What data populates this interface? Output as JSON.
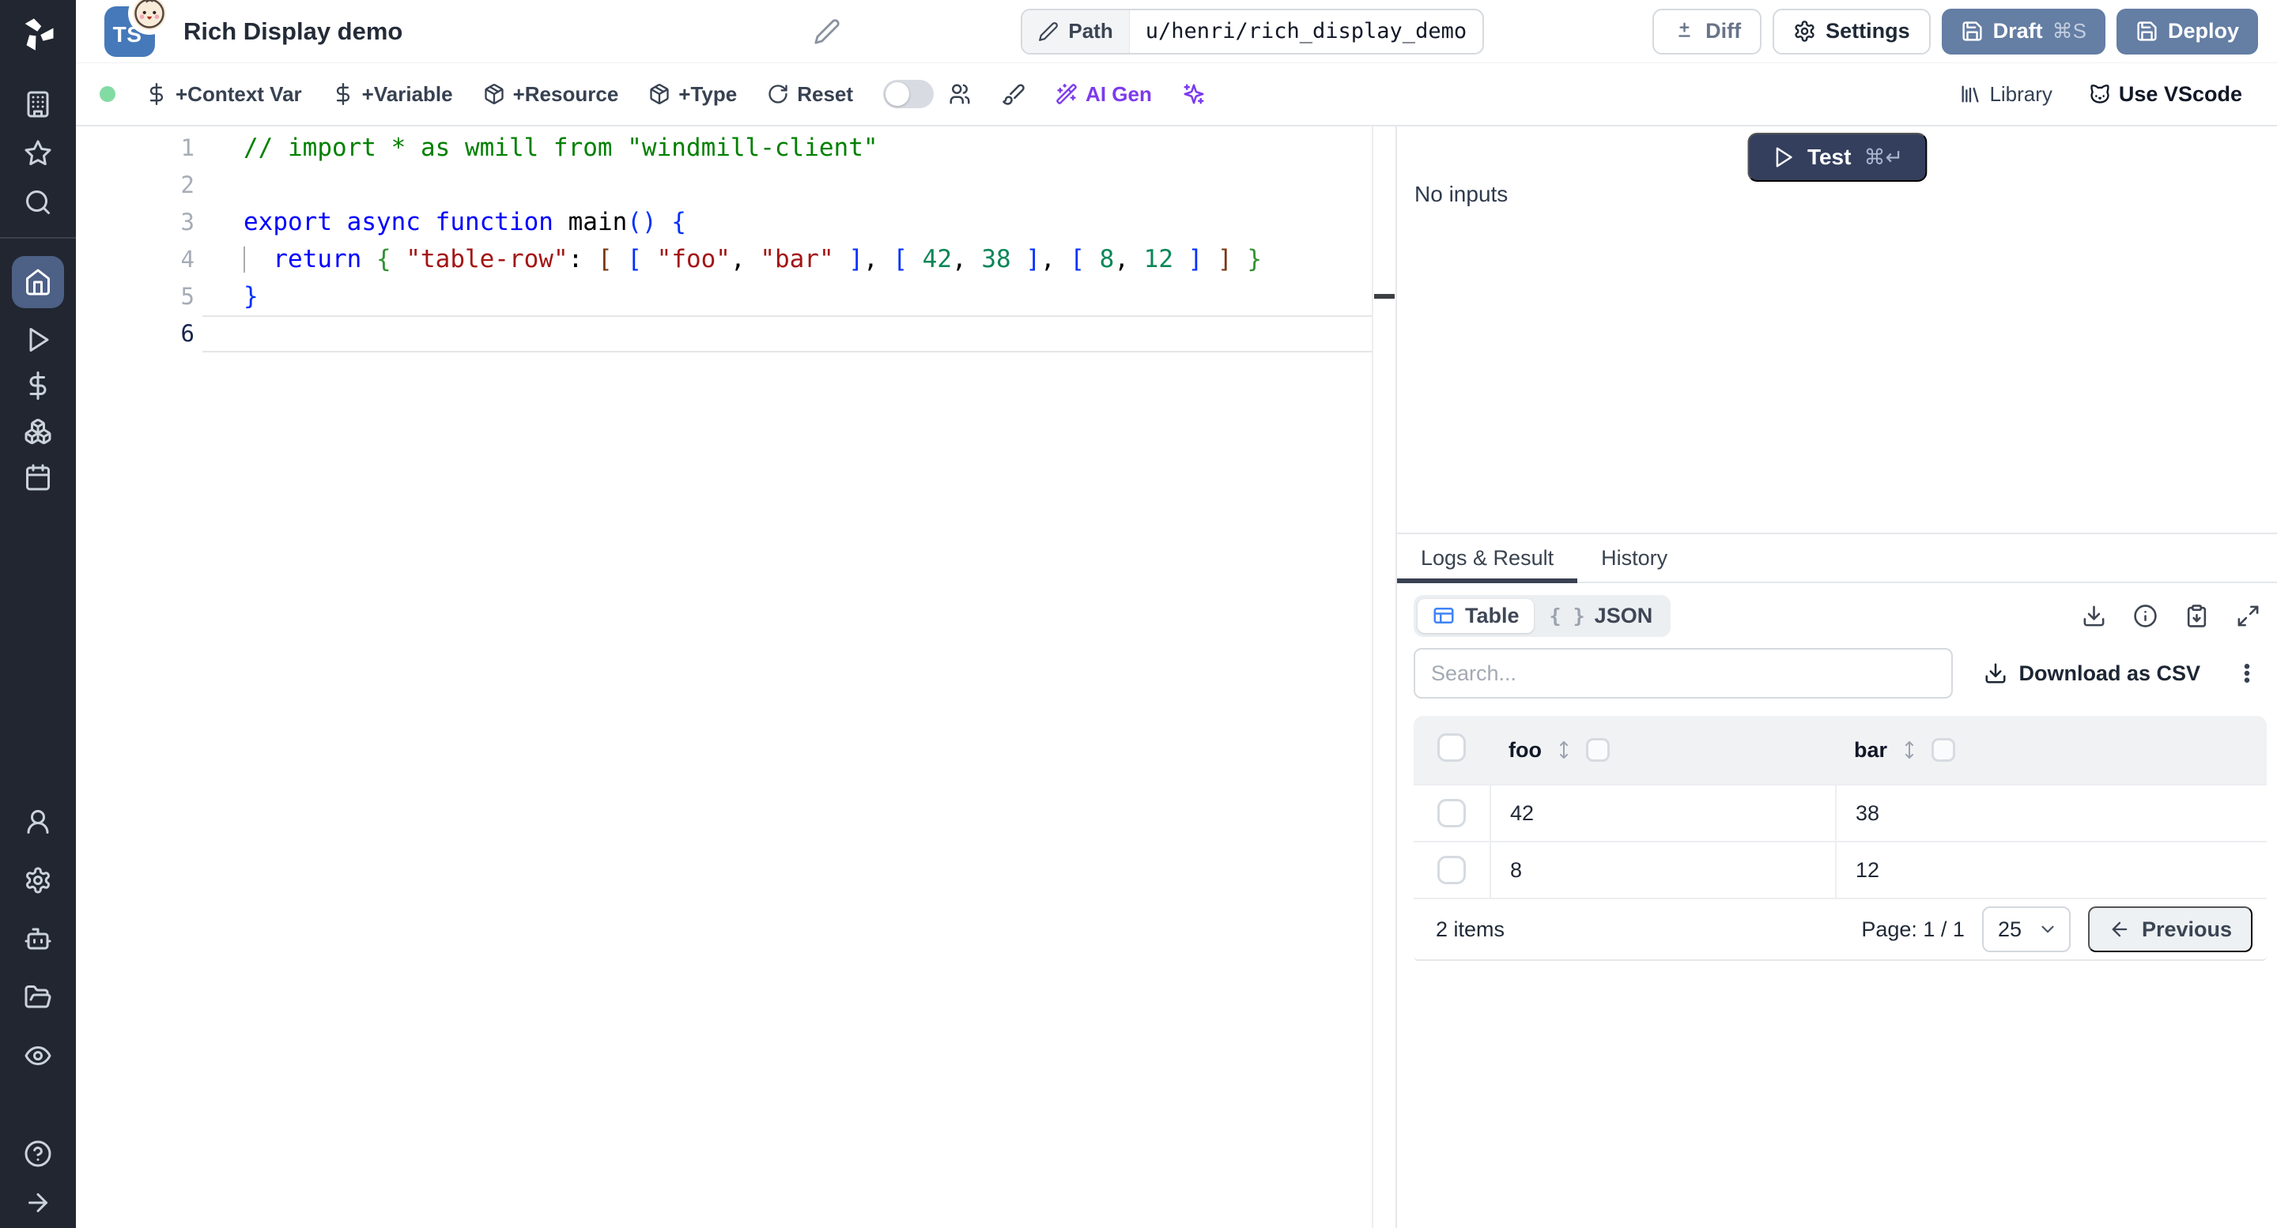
{
  "header": {
    "language_badge": "TS",
    "title": "Rich Display demo",
    "path_label": "Path",
    "path_value": "u/henri/rich_display_demo",
    "diff_label": "Diff",
    "settings_label": "Settings",
    "draft_label": "Draft",
    "draft_shortcut": "⌘S",
    "deploy_label": "Deploy"
  },
  "toolbar": {
    "context_var_label": "+Context Var",
    "variable_label": "+Variable",
    "resource_label": "+Resource",
    "type_label": "+Type",
    "reset_label": "Reset",
    "ai_gen_label": "AI Gen",
    "library_label": "Library",
    "vscode_label": "Use VScode"
  },
  "editor": {
    "lines": [
      {
        "num": "1",
        "tokens": [
          {
            "t": "// import * as wmill from \"windmill-client\"",
            "c": "comment"
          }
        ]
      },
      {
        "num": "2",
        "tokens": []
      },
      {
        "num": "3",
        "tokens": [
          {
            "t": "export",
            "c": "kw"
          },
          {
            "t": " ",
            "c": "plain"
          },
          {
            "t": "async",
            "c": "kw"
          },
          {
            "t": " ",
            "c": "plain"
          },
          {
            "t": "function",
            "c": "kw"
          },
          {
            "t": " ",
            "c": "plain"
          },
          {
            "t": "main",
            "c": "plain"
          },
          {
            "t": "()",
            "c": "b1"
          },
          {
            "t": " ",
            "c": "plain"
          },
          {
            "t": "{",
            "c": "b1"
          }
        ]
      },
      {
        "num": "4",
        "guide": true,
        "tokens": [
          {
            "t": "  ",
            "c": "plain"
          },
          {
            "t": "return",
            "c": "kw"
          },
          {
            "t": " ",
            "c": "plain"
          },
          {
            "t": "{",
            "c": "b2"
          },
          {
            "t": " ",
            "c": "plain"
          },
          {
            "t": "\"table-row\"",
            "c": "str"
          },
          {
            "t": ": ",
            "c": "plain"
          },
          {
            "t": "[",
            "c": "b3"
          },
          {
            "t": " ",
            "c": "plain"
          },
          {
            "t": "[",
            "c": "b1"
          },
          {
            "t": " ",
            "c": "plain"
          },
          {
            "t": "\"foo\"",
            "c": "str"
          },
          {
            "t": ", ",
            "c": "plain"
          },
          {
            "t": "\"bar\"",
            "c": "str"
          },
          {
            "t": " ",
            "c": "plain"
          },
          {
            "t": "]",
            "c": "b1"
          },
          {
            "t": ", ",
            "c": "plain"
          },
          {
            "t": "[",
            "c": "b1"
          },
          {
            "t": " ",
            "c": "plain"
          },
          {
            "t": "42",
            "c": "num"
          },
          {
            "t": ", ",
            "c": "plain"
          },
          {
            "t": "38",
            "c": "num"
          },
          {
            "t": " ",
            "c": "plain"
          },
          {
            "t": "]",
            "c": "b1"
          },
          {
            "t": ", ",
            "c": "plain"
          },
          {
            "t": "[",
            "c": "b1"
          },
          {
            "t": " ",
            "c": "plain"
          },
          {
            "t": "8",
            "c": "num"
          },
          {
            "t": ", ",
            "c": "plain"
          },
          {
            "t": "12",
            "c": "num"
          },
          {
            "t": " ",
            "c": "plain"
          },
          {
            "t": "]",
            "c": "b1"
          },
          {
            "t": " ",
            "c": "plain"
          },
          {
            "t": "]",
            "c": "b3"
          },
          {
            "t": " ",
            "c": "plain"
          },
          {
            "t": "}",
            "c": "b2"
          }
        ]
      },
      {
        "num": "5",
        "tokens": [
          {
            "t": "}",
            "c": "b1"
          }
        ]
      },
      {
        "num": "6",
        "current": true,
        "tokens": []
      }
    ]
  },
  "run_panel": {
    "test_label": "Test",
    "test_shortcut": "⌘↵",
    "no_inputs": "No inputs"
  },
  "results": {
    "tab_logs": "Logs & Result",
    "tab_history": "History",
    "view_table_label": "Table",
    "view_json_label": "JSON",
    "json_icon": "{ }",
    "search_placeholder": "Search...",
    "download_csv_label": "Download as CSV",
    "table": {
      "columns": [
        "foo",
        "bar"
      ],
      "rows": [
        [
          "42",
          "38"
        ],
        [
          "8",
          "12"
        ]
      ],
      "items_label": "2 items",
      "page_label": "Page: 1 / 1",
      "page_size": "25",
      "previous_label": "Previous"
    }
  },
  "colors": {
    "sidebar_bg": "#212631",
    "sidebar_active_bg": "#4d6085",
    "primary_button": "#647ea4",
    "test_button": "#343f5e",
    "ai_accent": "#7c3aed",
    "status_green": "#83dba4",
    "ts_badge_blue": "#4679ba",
    "table_icon_blue": "#3f83f8"
  }
}
